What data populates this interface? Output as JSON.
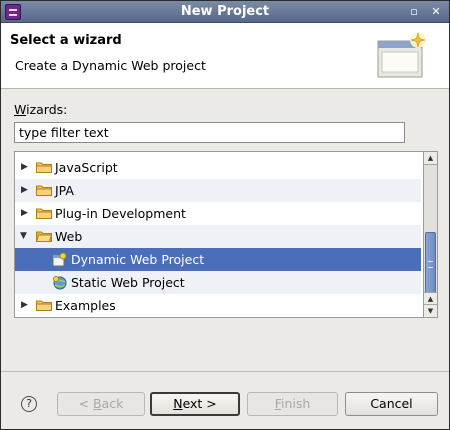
{
  "window": {
    "title": "New Project"
  },
  "titlebar": {
    "minimize_glyph": "▫",
    "close_glyph": "✕"
  },
  "header": {
    "title": "Select a wizard",
    "subtitle": "Create a Dynamic Web project",
    "graphic_icon": "wizard-banner-icon"
  },
  "wizards_label": {
    "mnemonic": "W",
    "rest": "izards:"
  },
  "filter": {
    "value": "type filter text"
  },
  "tree": {
    "rows": [
      {
        "label": "JavaScript",
        "type": "folder",
        "expanded": false
      },
      {
        "label": "JPA",
        "type": "folder",
        "expanded": false
      },
      {
        "label": "Plug-in Development",
        "type": "folder",
        "expanded": false
      },
      {
        "label": "Web",
        "type": "folder",
        "expanded": true
      },
      {
        "label": "Dynamic Web Project",
        "type": "project",
        "selected": true
      },
      {
        "label": "Static Web Project",
        "type": "project"
      },
      {
        "label": "Examples",
        "type": "folder",
        "expanded": false
      }
    ]
  },
  "buttons": {
    "help_glyph": "?",
    "back": {
      "lt": "< ",
      "mnemonic": "B",
      "rest": "ack"
    },
    "next": {
      "mnemonic": "N",
      "rest": "ext >"
    },
    "finish": {
      "mnemonic": "F",
      "rest": "inish"
    },
    "cancel": "Cancel"
  },
  "colors": {
    "selection": "#4a6fb8",
    "titlebar": "#6a7b9a",
    "folder": "#e8b34a"
  }
}
